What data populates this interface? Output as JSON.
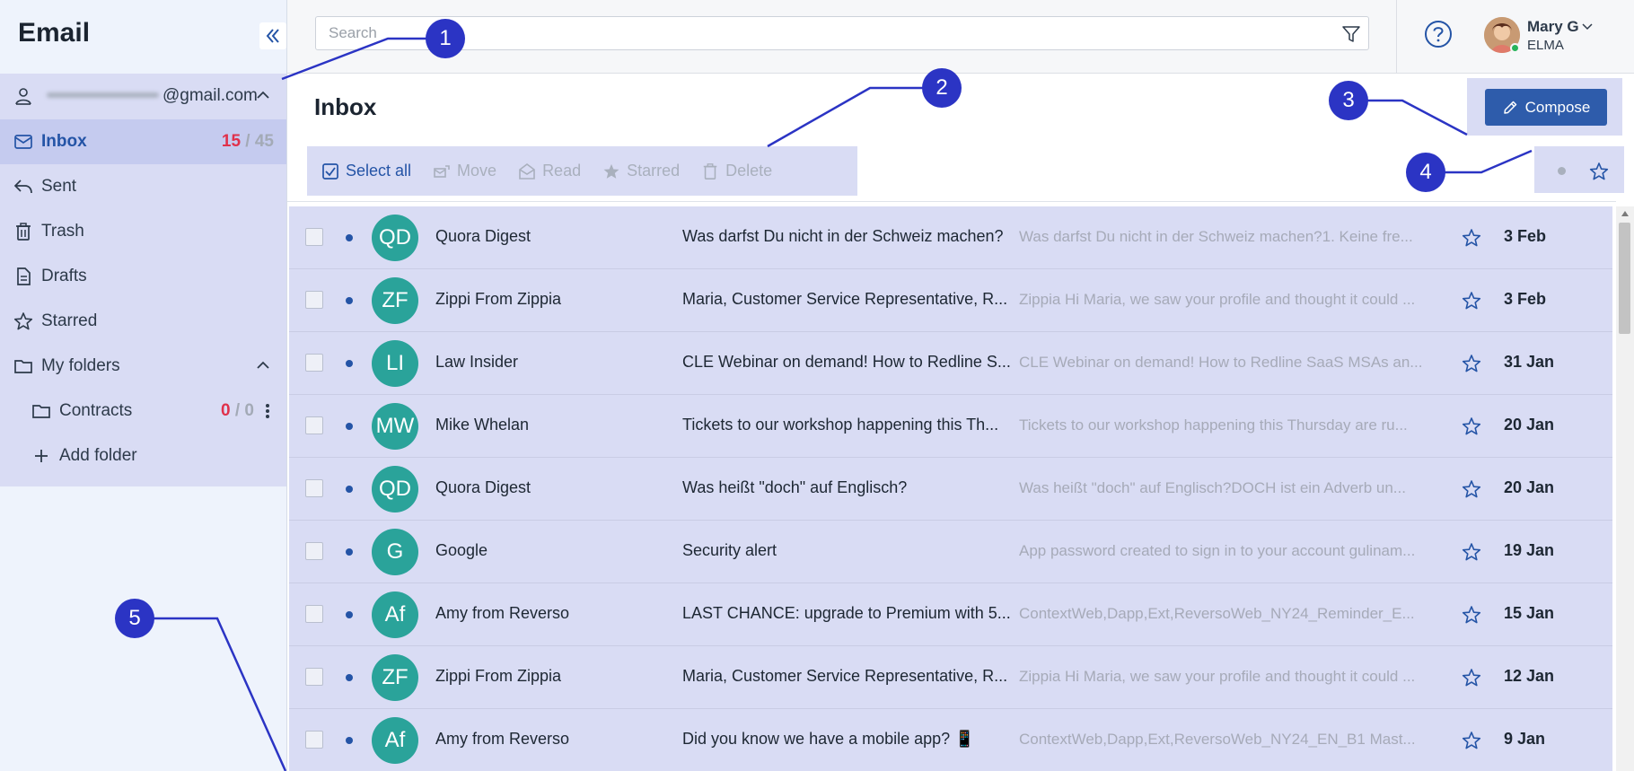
{
  "app": {
    "title": "Email"
  },
  "sidebar": {
    "account_suffix": "@gmail.com",
    "inbox": {
      "label": "Inbox",
      "unread": "15",
      "sep": "/",
      "total": "45"
    },
    "sent": "Sent",
    "trash": "Trash",
    "drafts": "Drafts",
    "starred": "Starred",
    "my_folders": "My folders",
    "contracts": {
      "label": "Contracts",
      "unread": "0",
      "sep": "/",
      "total": "0"
    },
    "add_folder": "Add folder"
  },
  "header": {
    "search_placeholder": "Search",
    "user": {
      "name": "Mary G",
      "org": "ELMA"
    }
  },
  "main": {
    "title": "Inbox",
    "compose_label": "Compose",
    "toolbar": {
      "select_all": "Select all",
      "move": "Move",
      "read": "Read",
      "starred": "Starred",
      "delete": "Delete"
    }
  },
  "messages": [
    {
      "initials": "QD",
      "sender": "Quora Digest",
      "subject": "Was darfst Du nicht in der Schweiz machen?",
      "preview": "Was darfst Du nicht in der Schweiz machen?1. Keine fre...",
      "date": "3 Feb"
    },
    {
      "initials": "ZF",
      "sender": "Zippi From Zippia",
      "subject": "Maria, Customer Service Representative, R...",
      "preview": "Zippia Hi Maria, we saw your profile and thought it could ...",
      "date": "3 Feb"
    },
    {
      "initials": "LI",
      "sender": "Law Insider",
      "subject": "CLE Webinar on demand! How to Redline S...",
      "preview": "CLE Webinar on demand! How to Redline SaaS MSAs an...",
      "date": "31 Jan"
    },
    {
      "initials": "MW",
      "sender": "Mike Whelan",
      "subject": "Tickets to our workshop happening this Th...",
      "preview": "Tickets to our workshop happening this Thursday are ru...",
      "date": "20 Jan"
    },
    {
      "initials": "QD",
      "sender": "Quora Digest",
      "subject": "Was heißt \"doch\" auf Englisch?",
      "preview": "Was heißt \"doch\" auf Englisch?DOCH ist ein Adverb un...",
      "date": "20 Jan"
    },
    {
      "initials": "G",
      "sender": "Google",
      "subject": "Security alert",
      "preview": "App password created to sign in to your account gulinam...",
      "date": "19 Jan"
    },
    {
      "initials": "Af",
      "sender": "Amy from Reverso",
      "subject": "LAST CHANCE: upgrade to Premium with 5...",
      "preview": "ContextWeb,Dapp,Ext,ReversoWeb_NY24_Reminder_E...",
      "date": "15 Jan"
    },
    {
      "initials": "ZF",
      "sender": "Zippi From Zippia",
      "subject": "Maria, Customer Service Representative, R...",
      "preview": "Zippia Hi Maria, we saw your profile and thought it could ...",
      "date": "12 Jan"
    },
    {
      "initials": "Af",
      "sender": "Amy from Reverso",
      "subject": "Did you know we have a mobile app? 📱",
      "preview": "ContextWeb,Dapp,Ext,ReversoWeb_NY24_EN_B1 Mast...",
      "date": "9 Jan"
    }
  ],
  "callouts": [
    "1",
    "2",
    "3",
    "4",
    "5"
  ],
  "colors": {
    "accent": "#2e5cab",
    "callout": "#2b34c4",
    "highlight": "#d9dcf4",
    "avatar": "#2aa39a",
    "unread_count": "#e0314b"
  }
}
